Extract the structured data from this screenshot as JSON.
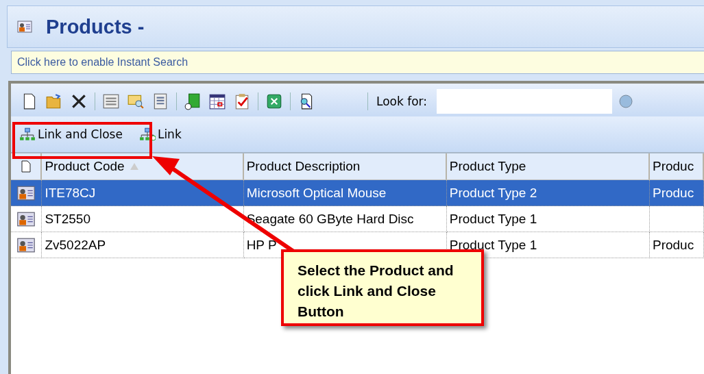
{
  "window": {
    "title": "Products -"
  },
  "instant_search": {
    "label": "Click here to enable Instant Search"
  },
  "toolbar": {
    "look_for_label": "Look for:"
  },
  "actions": [
    {
      "label": "Link and Close",
      "kind": "link-close"
    },
    {
      "label": "Link",
      "kind": "link"
    }
  ],
  "table": {
    "columns": [
      "Product Code",
      "Product Description",
      "Product Type",
      "Produc"
    ],
    "rows": [
      {
        "selected": true,
        "cells": [
          "ITE78CJ",
          "Microsoft Optical Mouse",
          "Product Type 2",
          "Produc"
        ]
      },
      {
        "selected": false,
        "cells": [
          "ST2550",
          "Seagate 60 GByte Hard Disc",
          "Product Type 1"
        ]
      },
      {
        "selected": false,
        "cells": [
          "Zv5022AP",
          "HP P",
          "Product Type 1",
          "Produc"
        ]
      }
    ]
  },
  "annotation": {
    "text": "Select the Product and click Link and Close Button"
  }
}
